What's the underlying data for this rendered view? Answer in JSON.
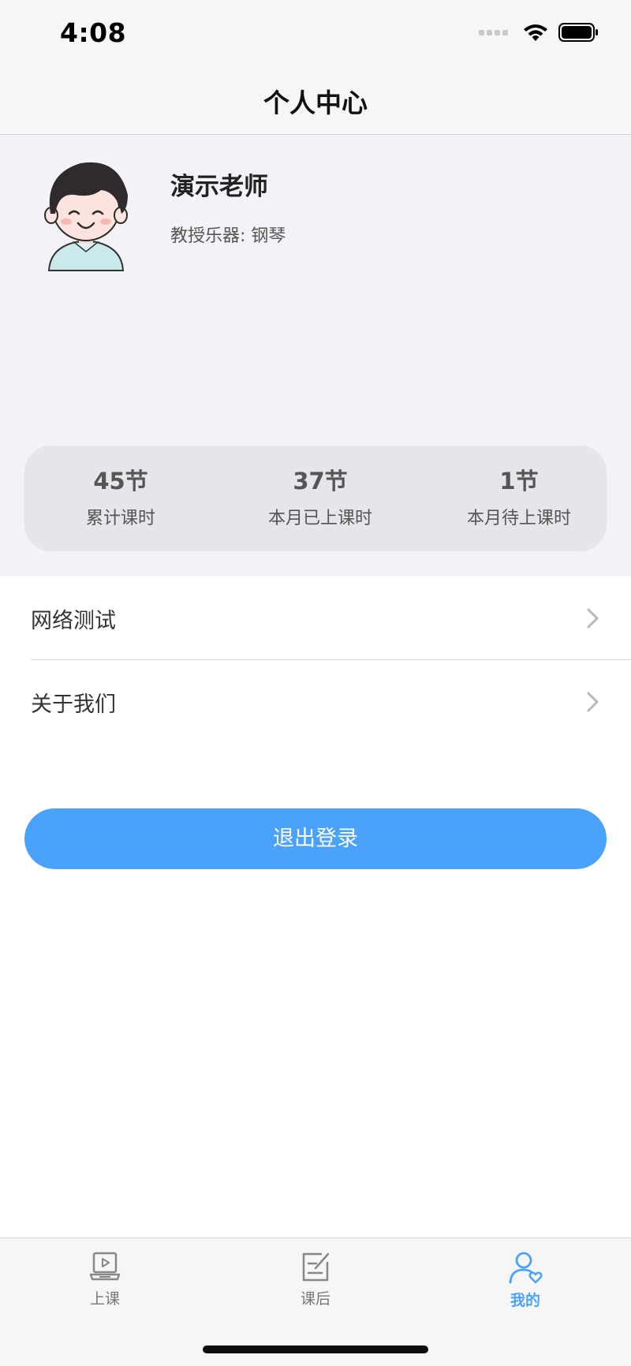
{
  "status_bar": {
    "time": "4:08",
    "icons": [
      "signal-icon",
      "wifi-icon",
      "battery-icon"
    ]
  },
  "nav": {
    "title": "个人中心"
  },
  "profile": {
    "name": "演示老师",
    "instrument": "教授乐器: 钢琴",
    "avatar_icon": "teacher-avatar-icon"
  },
  "stats": [
    {
      "value": "45节",
      "label": "累计课时"
    },
    {
      "value": "37节",
      "label": "本月已上课时"
    },
    {
      "value": "1节",
      "label": "本月待上课时"
    }
  ],
  "menu": [
    {
      "label": "网络测试",
      "icon": "chevron-right-icon"
    },
    {
      "label": "关于我们",
      "icon": "chevron-right-icon"
    }
  ],
  "logout": {
    "label": "退出登录"
  },
  "tabs": [
    {
      "label": "上课",
      "icon": "video-lesson-icon",
      "active": false
    },
    {
      "label": "课后",
      "icon": "edit-note-icon",
      "active": false
    },
    {
      "label": "我的",
      "icon": "user-heart-icon",
      "active": true
    }
  ],
  "colors": {
    "accent": "#4aa2fa",
    "profile_bg": "#f2f2f7",
    "stats_bg": "#e5e5ea"
  }
}
